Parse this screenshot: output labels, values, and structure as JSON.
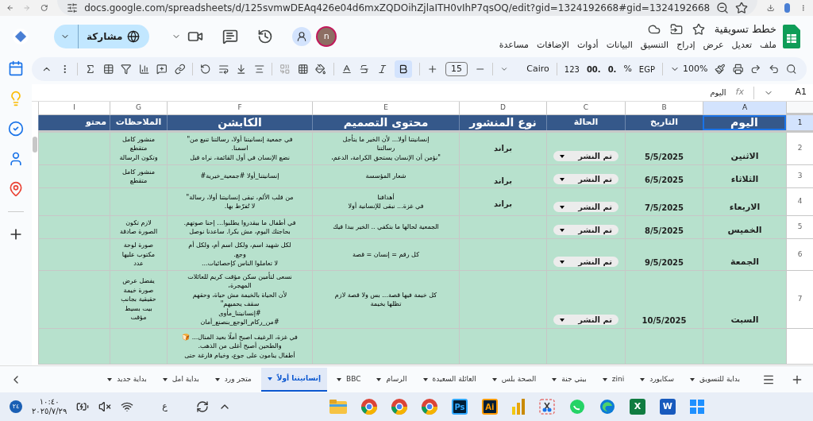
{
  "browser": {
    "url": "docs.google.com/spreadsheets/d/125svmwDEAq426e04d6mxZQDOihZjlaITH0vIhP7qsOQ/edit?gid=1324192668#gid=1324192668"
  },
  "document": {
    "title": "خطط تسويقية",
    "menu": [
      "ملف",
      "تعديل",
      "عرض",
      "إدراج",
      "التنسيق",
      "البيانات",
      "أدوات",
      "الإضافات",
      "مساعدة"
    ]
  },
  "account": {
    "avatar": "n"
  },
  "share_button": {
    "label": "مشاركة"
  },
  "toolbar": {
    "zoom": "100%",
    "currency": "EGP",
    "percent": "%",
    "decrease_decimals": ".0",
    "increase_decimals": ".00",
    "number_format": "123",
    "font": "Cairo",
    "font_size": "15"
  },
  "formula_bar": {
    "cell": "A1",
    "fx": "fx",
    "value": "اليوم"
  },
  "columns": [
    {
      "letter": "A",
      "selected": true
    },
    {
      "letter": "B",
      "selected": false
    },
    {
      "letter": "C",
      "selected": false
    },
    {
      "letter": "D",
      "selected": false
    },
    {
      "letter": "E",
      "selected": false
    },
    {
      "letter": "F",
      "selected": false
    },
    {
      "letter": "G",
      "selected": false
    },
    {
      "letter": "I",
      "selected": false
    }
  ],
  "header_row": {
    "number": "1",
    "cells": [
      "اليوم",
      "التاريخ",
      "الحالة",
      "نوع المنشور",
      "محتوى التصميم",
      "الكابشن",
      "الملاحظات",
      "محتو"
    ]
  },
  "rows": [
    {
      "number": "2",
      "day": "الاثنين",
      "date": "5/5/2025",
      "status": "تم النشر",
      "post_type": "براند",
      "design": [
        "إنسانيتنا أولا... لأن الخير ما يتأجل",
        "رسالتنا",
        "\"نؤمن أن الإنسان يستحق الكرامة، الدعم،"
      ],
      "caption": [
        "في جمعية إنسانيتنا أولا، رسالتنا تنبع من\"",
        "اسمنا.",
        "نضع الإنسان في أول القائمة، نراه قبل"
      ],
      "notes": [
        "منشور كامل",
        "متقطع",
        "وتكون الرسالة"
      ]
    },
    {
      "number": "3",
      "day": "الثلاثاء",
      "date": "6/5/2025",
      "status": "تم النشر",
      "post_type": "براند",
      "design": [
        "شعار المؤسسة"
      ],
      "caption": [
        "إنسانيتنا_أولا #جمعية_خيرية#"
      ],
      "notes": [
        "منشور كامل",
        "متقطع"
      ]
    },
    {
      "number": "4",
      "day": "الاربعاء",
      "date": "7/5/2025",
      "status": "تم النشر",
      "post_type": "براند",
      "design": [
        "أهدافنا",
        "في غزة... نبقى للإنسانية أولا"
      ],
      "caption": [
        "من قلب الألم، تبقى إنسانيتنا أولا، رسالة\"",
        "لا نُفرّط بها."
      ],
      "notes": []
    },
    {
      "number": "5",
      "day": "الخميس",
      "date": "8/5/2025",
      "status": "تم النشر",
      "design": [
        "الجمعية لحالها ما بتكفي .. الخير ببدا فيك"
      ],
      "caption": [
        "في أطفال ما بيقدروا يطلبوا… إحنا صوتهم.",
        "بحاجتك اليوم، مش بكرا. ساعدنا نوصل"
      ],
      "notes": [
        "لازم تكون",
        "الصورة صادقة"
      ]
    },
    {
      "number": "6",
      "day": "الجمعة",
      "date": "9/5/2025",
      "status": "تم النشر",
      "design": [
        "كل رقم = إنسان = قصة"
      ],
      "caption": [
        "لكل شهيد اسم، ولكل اسم أم، ولكل أم",
        "وجع.",
        "لا تعاملوا الناس كإحصائيات..."
      ],
      "notes": [
        "صورة لوحة",
        "مكتوب عليها",
        "عدد"
      ]
    },
    {
      "number": "7",
      "day": "السبت",
      "date": "10/5/2025",
      "status": "تم النشر",
      "design": [
        "كل خيمة فيها قصة... بس ولا قصة لازم",
        "تظلها بخيمة"
      ],
      "caption": [
        "نسعى لتأمين سكن مؤقت كريم للعائلات",
        "المهجرة،",
        "لأن الحياة بالخيمة مش حياة، وحقهم",
        "سقف يحميهم\"",
        "#إنسانيتنا_مأوى",
        "#من_ركام_الوجع_بنصنع_أمان"
      ],
      "notes": [
        "يفضل عرض",
        "صورة خيمة",
        "حقيقية  بجانب",
        "بيت بسيط",
        "مؤقت"
      ]
    },
    {
      "design": [],
      "caption": [
        "في غزة، الرغيف اصبح أملًا بعيد المنال... 🍞",
        "والطحين أصبح أغلى من الذهب.",
        "أطفال ينامون على جوع، وخيام فارغة حتى"
      ],
      "notes": []
    }
  ],
  "sheet_tabs": [
    {
      "label": "بداية للتسويق",
      "selected": false
    },
    {
      "label": "سكايورد",
      "selected": false
    },
    {
      "label": "zini",
      "selected": false
    },
    {
      "label": "بيتي جنة",
      "selected": false
    },
    {
      "label": "الصحة بلس",
      "selected": false
    },
    {
      "label": "العائلة السعيدة",
      "selected": false
    },
    {
      "label": "الرسام",
      "selected": false
    },
    {
      "label": "BBC",
      "selected": false
    },
    {
      "label": "إنسانيتنا أولاً",
      "selected": true
    },
    {
      "label": "متجر ورد",
      "selected": false
    },
    {
      "label": "بداية امل",
      "selected": false
    },
    {
      "label": "بداية جديد",
      "selected": false
    }
  ],
  "taskbar": {
    "notifications": "٢٤",
    "time": "١٠:٤٠",
    "date": "٢٠٢٥/٧/٢٩",
    "language": "ع",
    "apps": [
      {
        "kind": "windows"
      },
      {
        "kind": "doc",
        "label": "W",
        "color": "#185abd"
      },
      {
        "kind": "doc",
        "label": "X",
        "color": "#107c41"
      },
      {
        "kind": "edge"
      },
      {
        "kind": "chat"
      },
      {
        "kind": "snip"
      },
      {
        "kind": "bars"
      },
      {
        "kind": "badge",
        "label": "Ai",
        "color": "#ff9a00"
      },
      {
        "kind": "badge",
        "label": "Ps",
        "color": "#31a8ff"
      },
      {
        "kind": "chrome"
      },
      {
        "kind": "chrome"
      },
      {
        "kind": "chrome"
      },
      {
        "kind": "folder"
      }
    ]
  }
}
